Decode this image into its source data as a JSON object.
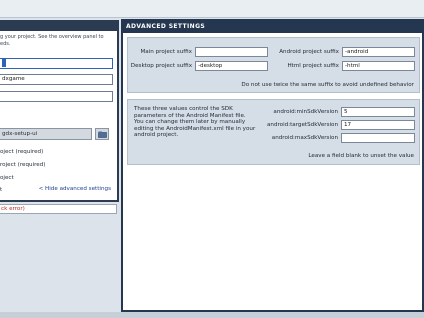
{
  "left": {
    "description": "g your project. See the overview panel to eds.",
    "name_value": "",
    "package_value": "dxgame",
    "class_value": "",
    "path_value": "gdx-setup-ui",
    "subprojects": [
      "oject (required)",
      "roject (required)",
      "oject",
      "t"
    ],
    "hide_link": "< Hide advanced settings",
    "status": "ck error)"
  },
  "advanced": {
    "title": "ADVANCED SETTINGS",
    "suffix": {
      "main_label": "Main project suffix",
      "main_value": "",
      "android_label": "Android project suffix",
      "android_value": "-android",
      "desktop_label": "Desktop project suffix",
      "desktop_value": "-desktop",
      "html_label": "Html project suffix",
      "html_value": "-html",
      "note": "Do not use twice the same suffix to avoid undefined behavior"
    },
    "sdk": {
      "description": "These three values control the SDK parameters of the Android Manifest file. You can change them later by manually editing the AndroidManifest.xml file in your android project.",
      "min_label": "android:minSdkVersion",
      "min_value": "5",
      "target_label": "android:targetSdkVersion",
      "target_value": "17",
      "max_label": "android:maxSdkVersion",
      "max_value": "",
      "note": "Leave a field blank to unset the value"
    }
  },
  "colors": {
    "header": "#243650",
    "group_bg": "#d5dde6",
    "link": "#1c3f8c",
    "error": "#c0281e"
  }
}
